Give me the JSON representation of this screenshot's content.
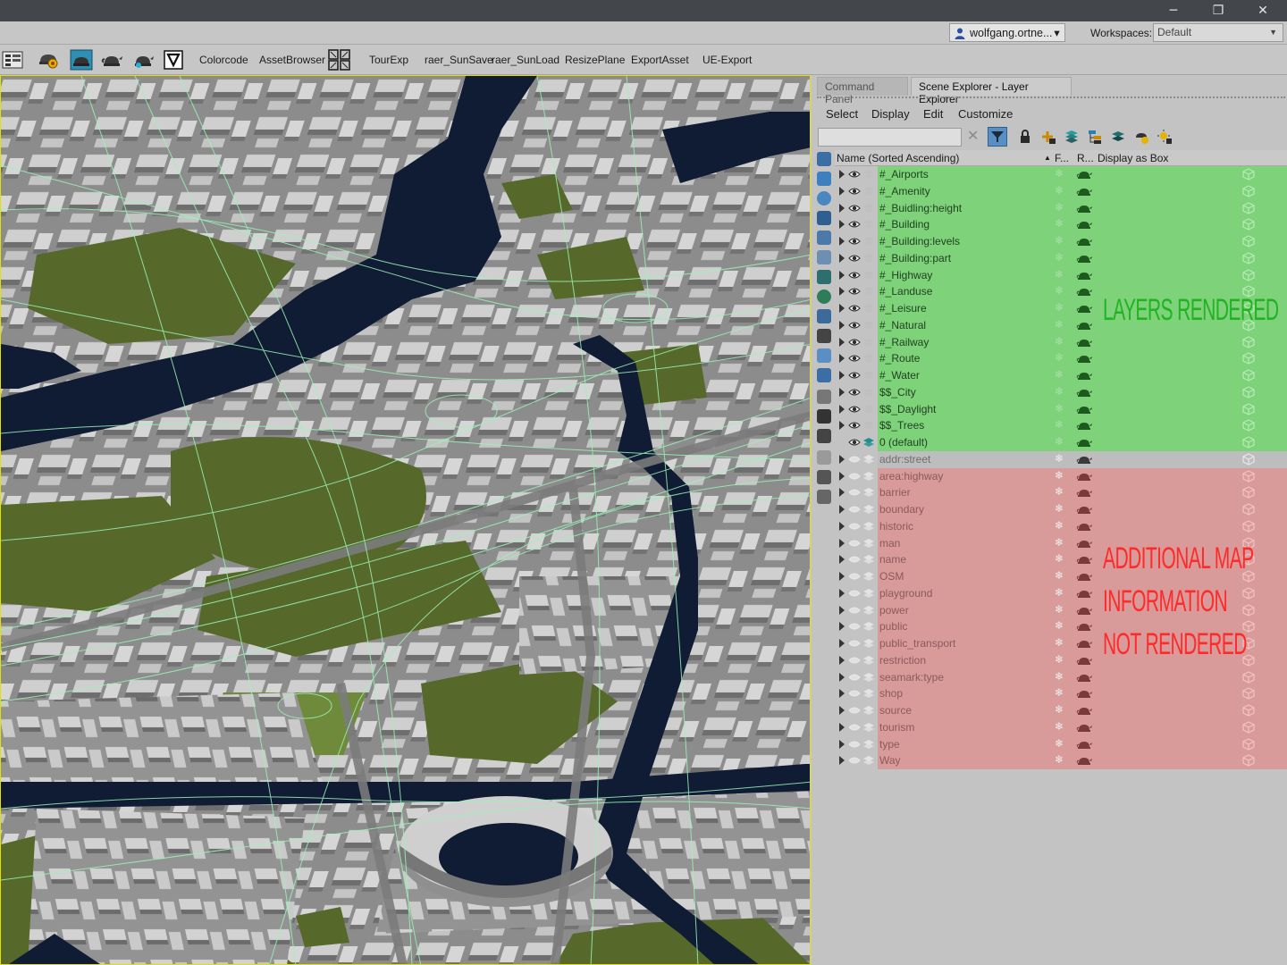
{
  "window": {
    "minimize_glyph": "─",
    "restore_glyph": "❐",
    "close_glyph": "✕"
  },
  "userbar": {
    "user": "wolfgang.ortne...",
    "user_arrow": "▾",
    "workspaces_label": "Workspaces:",
    "workspace_value": "Default",
    "workspace_arrow": "▼"
  },
  "toolbar": {
    "items": [
      "Colorcode",
      "AssetBrowser",
      "TourExp",
      "raer_SunSave",
      "raer_SunLoad",
      "ResizePlane",
      "ExportAsset",
      "UE-Export"
    ],
    "icons": [
      "layer-manager-icon",
      "render-setup-icon",
      "render-frame-icon",
      "render-teapot-icon",
      "render-teapot-active-icon",
      "v-ray-icon",
      "grid-tool-icon"
    ]
  },
  "panel": {
    "tabs": [
      "Command Panel",
      "Scene Explorer - Layer Explorer"
    ],
    "menu": [
      "Select",
      "Display",
      "Edit",
      "Customize"
    ],
    "search_placeholder": "",
    "clear_glyph": "✕",
    "columns": {
      "name": "Name (Sorted Ascending)",
      "sort_arrow": "▲",
      "frozen": "F...",
      "renderable": "R...",
      "display_as_box": "Display as Box"
    }
  },
  "layers_rendered": [
    "#_Airports",
    "#_Amenity",
    "#_Buidling:height",
    "#_Building",
    "#_Building:levels",
    "#_Building:part",
    "#_Highway",
    "#_Landuse",
    "#_Leisure",
    "#_Natural",
    "#_Railway",
    "#_Route",
    "#_Water",
    "$$_City",
    "$$_Daylight",
    "$$_Trees",
    "0 (default)"
  ],
  "layer_neutral": [
    "addr:street"
  ],
  "layers_not_rendered": [
    "area:highway",
    "barrier",
    "boundary",
    "historic",
    "man",
    "name",
    "OSM",
    "playground",
    "power",
    "public",
    "public_transport",
    "restriction",
    "seamark:type",
    "shop",
    "source",
    "tourism",
    "type",
    "Way"
  ],
  "annotations": {
    "rendered": "LAYERS RENDERED",
    "not_rendered_1": "ADDITIONAL MAP",
    "not_rendered_2": "INFORMATION",
    "not_rendered_3": "NOT RENDERED"
  },
  "colors": {
    "rendered_row": "#7ed27a",
    "neutral_row": "#bdbdbd",
    "not_rendered_row": "#d99a9a",
    "annotation_green": "#22b322",
    "annotation_red": "#ff2a2a",
    "viewport_border": "#e4e000"
  }
}
